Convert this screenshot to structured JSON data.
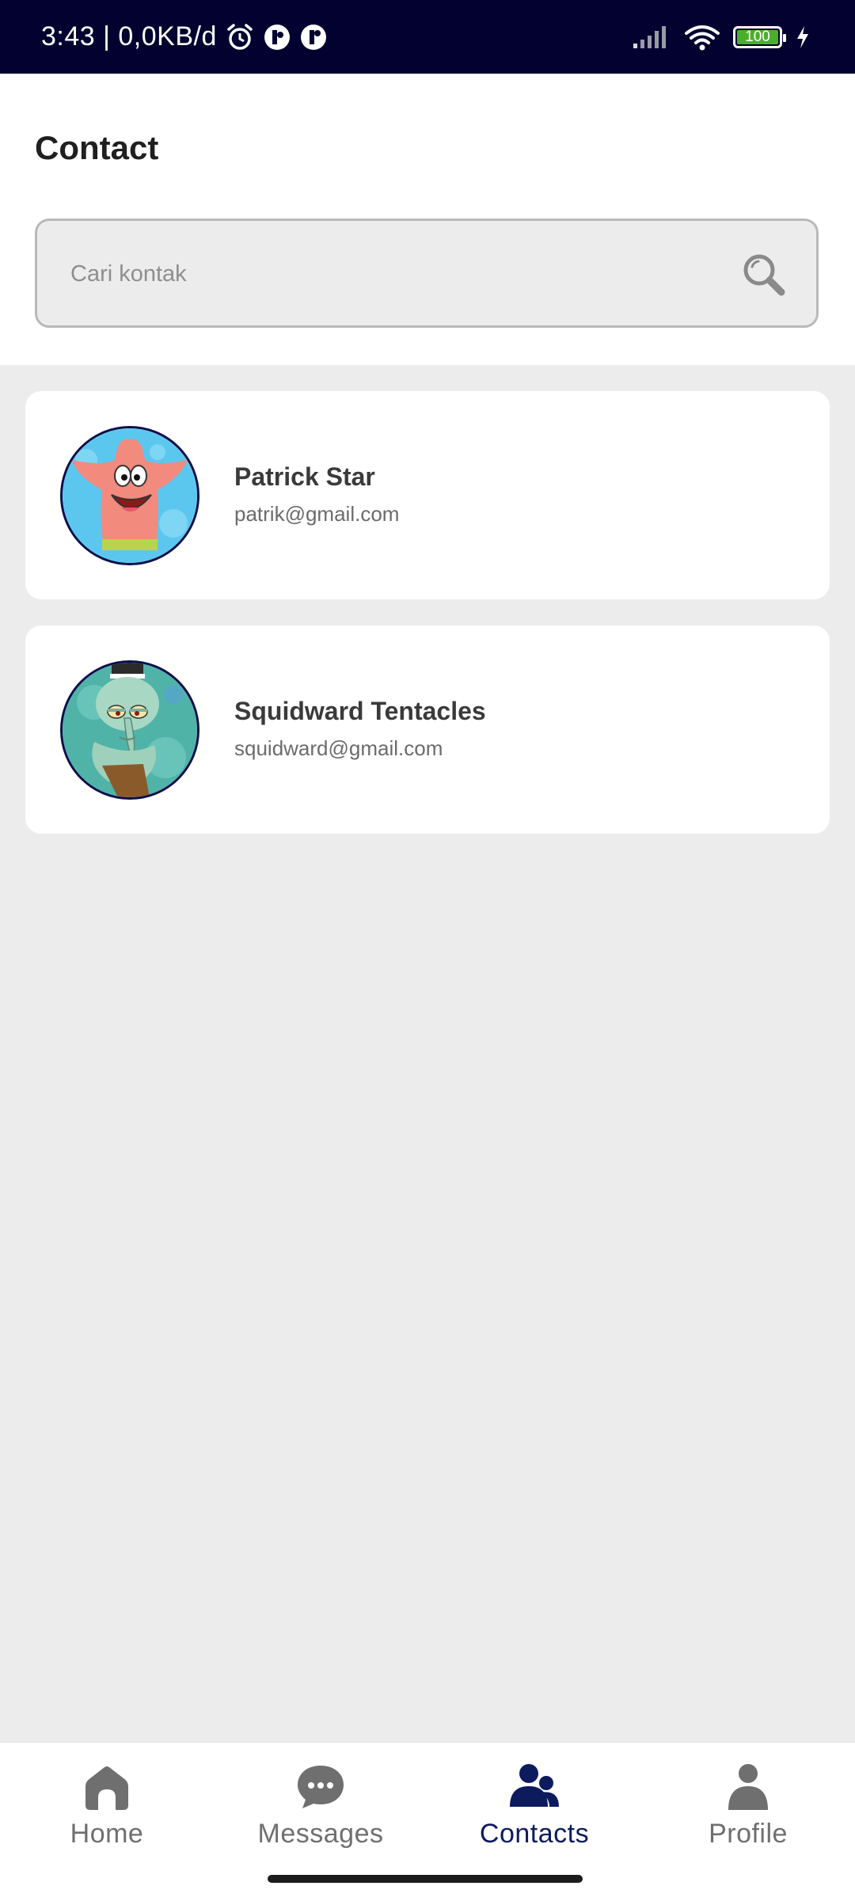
{
  "status_bar": {
    "time_info": "3:43 | 0,0KB/d",
    "battery": "100",
    "battery_level": 1.0,
    "icons": [
      "alarm-icon",
      "app-notification-icon",
      "app-notification-icon",
      "signal-icon",
      "wifi-icon",
      "battery-icon",
      "charging-icon"
    ]
  },
  "header": {
    "title": "Contact",
    "search_placeholder": "Cari kontak",
    "search_value": ""
  },
  "contacts": [
    {
      "name": "Patrick Star",
      "email": "patrik@gmail.com",
      "avatar": "patrick-star-avatar"
    },
    {
      "name": "Squidward Tentacles",
      "email": "squidward@gmail.com",
      "avatar": "squidward-avatar"
    }
  ],
  "bottom_nav": {
    "items": [
      {
        "label": "Home",
        "icon": "home-icon",
        "active": false
      },
      {
        "label": "Messages",
        "icon": "chat-bubble-icon",
        "active": false
      },
      {
        "label": "Contacts",
        "icon": "contacts-icon",
        "active": true
      },
      {
        "label": "Profile",
        "icon": "profile-icon",
        "active": false
      }
    ]
  },
  "colors": {
    "status_bar_bg": "#02012f",
    "accent": "#0e1a5e",
    "inactive": "#6f6f6f",
    "page_bg": "#ececec",
    "battery_fill": "#4caf2a"
  }
}
